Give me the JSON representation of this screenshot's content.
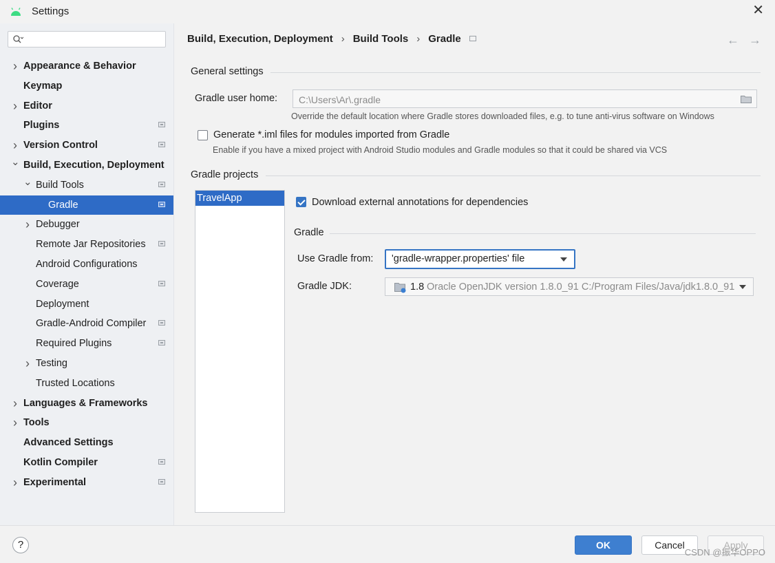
{
  "window": {
    "title": "Settings",
    "close_glyph": "✕",
    "app_icon": "android-icon"
  },
  "sidebar": {
    "search": {
      "value": "",
      "placeholder": ""
    },
    "items": [
      {
        "label": "Appearance & Behavior",
        "level": 0,
        "expandable": true,
        "expanded": false,
        "bold": true,
        "project_badge": false
      },
      {
        "label": "Keymap",
        "level": 0,
        "expandable": false,
        "bold": true,
        "project_badge": false
      },
      {
        "label": "Editor",
        "level": 0,
        "expandable": true,
        "expanded": false,
        "bold": true,
        "project_badge": false
      },
      {
        "label": "Plugins",
        "level": 0,
        "expandable": false,
        "bold": true,
        "project_badge": true
      },
      {
        "label": "Version Control",
        "level": 0,
        "expandable": true,
        "expanded": false,
        "bold": true,
        "project_badge": true
      },
      {
        "label": "Build, Execution, Deployment",
        "level": 0,
        "expandable": true,
        "expanded": true,
        "bold": true,
        "project_badge": false
      },
      {
        "label": "Build Tools",
        "level": 1,
        "expandable": true,
        "expanded": true,
        "bold": false,
        "project_badge": true
      },
      {
        "label": "Gradle",
        "level": 2,
        "expandable": false,
        "bold": false,
        "project_badge": true,
        "selected": true
      },
      {
        "label": "Debugger",
        "level": 1,
        "expandable": true,
        "expanded": false,
        "bold": false,
        "project_badge": false
      },
      {
        "label": "Remote Jar Repositories",
        "level": 1,
        "expandable": false,
        "bold": false,
        "project_badge": true
      },
      {
        "label": "Android Configurations",
        "level": 1,
        "expandable": false,
        "bold": false,
        "project_badge": false
      },
      {
        "label": "Coverage",
        "level": 1,
        "expandable": false,
        "bold": false,
        "project_badge": true
      },
      {
        "label": "Deployment",
        "level": 1,
        "expandable": false,
        "bold": false,
        "project_badge": false
      },
      {
        "label": "Gradle-Android Compiler",
        "level": 1,
        "expandable": false,
        "bold": false,
        "project_badge": true
      },
      {
        "label": "Required Plugins",
        "level": 1,
        "expandable": false,
        "bold": false,
        "project_badge": true
      },
      {
        "label": "Testing",
        "level": 1,
        "expandable": true,
        "expanded": false,
        "bold": false,
        "project_badge": false
      },
      {
        "label": "Trusted Locations",
        "level": 1,
        "expandable": false,
        "bold": false,
        "project_badge": false
      },
      {
        "label": "Languages & Frameworks",
        "level": 0,
        "expandable": true,
        "expanded": false,
        "bold": true,
        "project_badge": false
      },
      {
        "label": "Tools",
        "level": 0,
        "expandable": true,
        "expanded": false,
        "bold": true,
        "project_badge": false
      },
      {
        "label": "Advanced Settings",
        "level": 0,
        "expandable": false,
        "bold": true,
        "project_badge": false
      },
      {
        "label": "Kotlin Compiler",
        "level": 0,
        "expandable": false,
        "bold": true,
        "project_badge": true
      },
      {
        "label": "Experimental",
        "level": 0,
        "expandable": true,
        "expanded": false,
        "bold": true,
        "project_badge": true
      }
    ]
  },
  "header": {
    "breadcrumb": [
      "Build, Execution, Deployment",
      "Build Tools",
      "Gradle"
    ],
    "separator": "›",
    "back_glyph": "←",
    "forward_glyph": "→"
  },
  "general": {
    "title": "General settings",
    "user_home_label": "Gradle user home:",
    "user_home_value": "C:\\Users\\Ar\\.gradle",
    "user_home_hint": "Override the default location where Gradle stores downloaded files, e.g. to tune anti-virus software on Windows",
    "iml_label": "Generate *.iml files for modules imported from Gradle",
    "iml_checked": false,
    "iml_hint": "Enable if you have a mixed project with Android Studio modules and Gradle modules so that it could be shared via VCS"
  },
  "projects": {
    "title": "Gradle projects",
    "list": [
      "TravelApp"
    ],
    "download_annotations_label": "Download external annotations for dependencies",
    "download_annotations_checked": true,
    "gradle_section_title": "Gradle",
    "use_gradle_from_label": "Use Gradle from:",
    "use_gradle_from_value": "'gradle-wrapper.properties' file",
    "jdk_label": "Gradle JDK:",
    "jdk_version": "1.8",
    "jdk_description": "Oracle OpenJDK version 1.8.0_91 C:/Program Files/Java/jdk1.8.0_91"
  },
  "footer": {
    "help_label": "?",
    "ok_label": "OK",
    "cancel_label": "Cancel",
    "apply_label": "Apply",
    "watermark": "CSDN @振华OPPO"
  },
  "colors": {
    "accent": "#2e6bc6",
    "ok_button": "#3e7fd0",
    "background": "#f2f2f2",
    "sidebar_bg": "#eef0f3"
  }
}
